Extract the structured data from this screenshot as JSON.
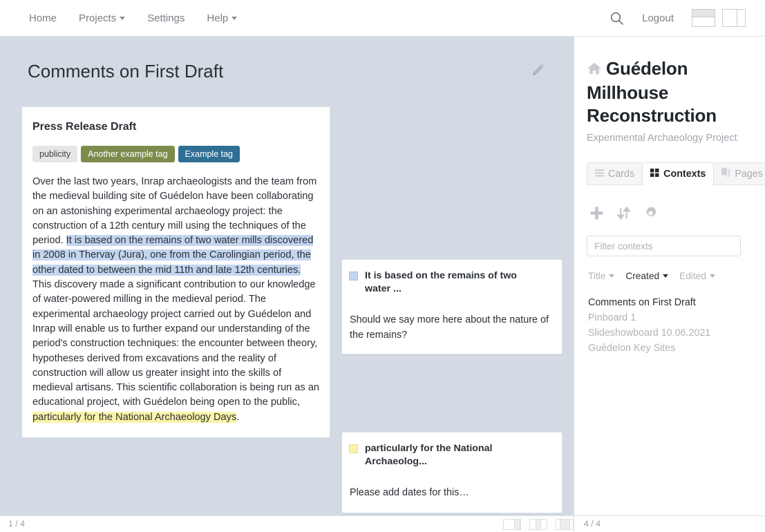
{
  "topnav": {
    "items": [
      {
        "label": "Home",
        "caret": false
      },
      {
        "label": "Projects",
        "caret": true
      },
      {
        "label": "Settings",
        "caret": false
      },
      {
        "label": "Help",
        "caret": true
      }
    ],
    "search_icon": "search-icon",
    "logout_label": "Logout",
    "layout_toggle_horizontal": "layout-horizontal-split-icon",
    "layout_toggle_vertical": "layout-vertical-split-icon"
  },
  "main": {
    "page_title": "Comments on First Draft",
    "edit_icon": "pencil-icon",
    "card": {
      "title": "Press Release Draft",
      "tags": [
        {
          "label": "publicity",
          "color": "#e6e6e6",
          "text_color": "#3c4146"
        },
        {
          "label": "Another example tag",
          "color": "#7d8c4d",
          "text_color": "#ffffff"
        },
        {
          "label": "Example tag",
          "color": "#2e6f94",
          "text_color": "#ffffff"
        }
      ],
      "body": {
        "part1": "Over the last two years, Inrap archaeologists and the team from the medieval building site of Guédelon have been collaborating on an astonishing experimental archaeology project: the construction of a 12th century mill using the techniques of the period. ",
        "highlight_blue": "It is based on the remains of two water mills discovered in 2008 in Thervay (Jura), one from the Carolingian period, the other dated to between the mid 11th and late 12th centuries.",
        "part2": " This discovery made a significant contribution to our knowledge of water-powered milling in the medieval period. The experimental archaeology project carried out by Guédelon and Inrap will enable us to further expand our understanding of the period's construction techniques: the encounter between theory, hypotheses derived from excavations and the reality of construction will allow us greater insight into the skills of medieval artisans. This scientific collaboration is being run as an educational project, with Guédelon being open to the public, ",
        "highlight_yellow": "particularly for the National Archaeology Days",
        "part3": "."
      },
      "highlight_blue_color": "#c3d5ef",
      "highlight_yellow_color": "#fbf4a8"
    },
    "comments": [
      {
        "swatch_color": "#c3d5ef",
        "quote": "It is based on the remains of two water ...",
        "text": "Should we say more here about the nature of the remains?"
      },
      {
        "swatch_color": "#fbf4a8",
        "quote": "particularly for the National Archaeolog...",
        "text": "Please add dates for this…"
      }
    ]
  },
  "sidebar": {
    "home_icon": "home-icon",
    "title": "Guédelon Millhouse Reconstruction",
    "subtitle": "Experimental Archaeology Project",
    "tabs": [
      {
        "label": "Cards",
        "icon": "list-lines-icon",
        "active": false
      },
      {
        "label": "Contexts",
        "icon": "grid-squares-icon",
        "active": true
      },
      {
        "label": "Pages",
        "icon": "pages-icon",
        "active": false
      }
    ],
    "tools": [
      {
        "name": "add-icon"
      },
      {
        "name": "sort-arrows-icon"
      },
      {
        "name": "gear-icon"
      }
    ],
    "filter_placeholder": "Filter contexts",
    "filter_value": "",
    "sort_options": [
      {
        "label": "Title",
        "active": false
      },
      {
        "label": "Created",
        "active": true
      },
      {
        "label": "Edited",
        "active": false
      }
    ],
    "contexts": [
      {
        "label": "Comments on First Draft",
        "active": true
      },
      {
        "label": "Pinboard 1",
        "active": false
      },
      {
        "label": "Slideshowboard 10.06.2021",
        "active": false
      },
      {
        "label": "Guédelon Key Sites",
        "active": false
      }
    ]
  },
  "statusbar": {
    "left_counter": "1 / 4",
    "right_counter": "4 / 4",
    "layout_icons": [
      {
        "name": "layout-wide-right-icon"
      },
      {
        "name": "layout-even-split-icon"
      },
      {
        "name": "layout-narrow-right-icon"
      }
    ]
  }
}
